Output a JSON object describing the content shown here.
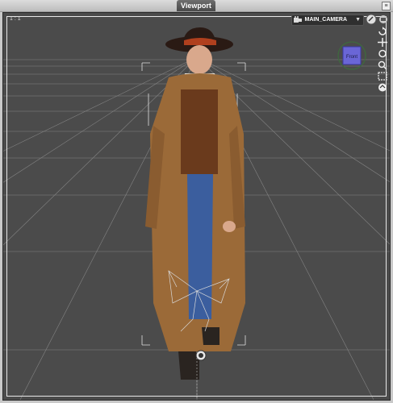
{
  "panel": {
    "title": "Viewport"
  },
  "viewport": {
    "aspect_label": "1 : 1",
    "camera": {
      "name": "MAIN_CAMERA"
    },
    "cube_face": "Front",
    "tools": [
      "rotate-icon",
      "pan-icon",
      "orbit-icon",
      "zoom-icon",
      "frame-icon",
      "home-icon"
    ],
    "colors": {
      "background": "#4b4b4b",
      "grid": "#8a8a8a",
      "cube": "#6a66d6"
    }
  }
}
